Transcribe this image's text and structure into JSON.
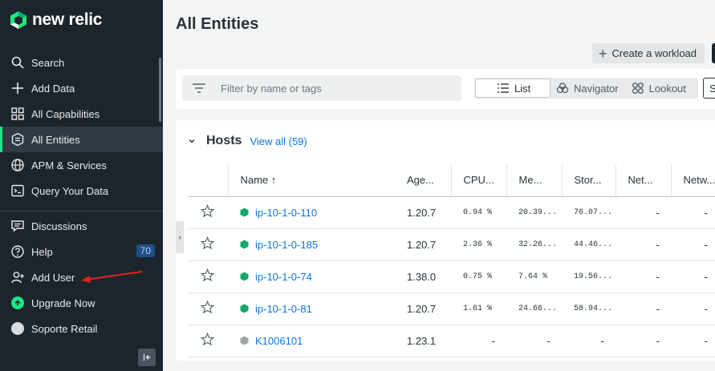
{
  "brand": {
    "name": "new relic",
    "accent": "#1ce783"
  },
  "sidebar": {
    "items": [
      {
        "label": "Search",
        "icon": "search-icon"
      },
      {
        "label": "Add Data",
        "icon": "plus-icon"
      },
      {
        "label": "All Capabilities",
        "icon": "grid-icon"
      },
      {
        "label": "All Entities",
        "icon": "entities-icon",
        "active": true
      },
      {
        "label": "APM & Services",
        "icon": "globe-icon"
      },
      {
        "label": "Query Your Data",
        "icon": "terminal-icon"
      }
    ],
    "bottom_items": [
      {
        "label": "Discussions",
        "icon": "chat-icon"
      },
      {
        "label": "Help",
        "icon": "help-icon",
        "badge": "70"
      },
      {
        "label": "Add User",
        "icon": "add-user-icon"
      },
      {
        "label": "Upgrade Now",
        "icon": "upgrade-icon"
      },
      {
        "label": "Soporte Retail",
        "icon": "avatar-icon"
      }
    ]
  },
  "main": {
    "title": "All Entities",
    "create_workload": "Create a workload",
    "filter_placeholder": "Filter by name or tags",
    "view_tabs": [
      "List",
      "Navigator",
      "Lookout"
    ],
    "view_tab_extra": "S",
    "section": {
      "title": "Hosts",
      "view_all": "View all (59)",
      "columns": [
        "Name ↑",
        "Age...",
        "CPU...",
        "Me...",
        "Stor...",
        "Net...",
        "Netw..."
      ],
      "rows": [
        {
          "name": "ip-10-1-0-110",
          "status": "healthy",
          "age": "1.20.7",
          "cpu": "0.94 %",
          "mem": "20.39...",
          "stor": "76.07...",
          "net": "-",
          "netw": "-"
        },
        {
          "name": "ip-10-1-0-185",
          "status": "healthy",
          "age": "1.20.7",
          "cpu": "2.36 %",
          "mem": "32.26...",
          "stor": "44.46...",
          "net": "-",
          "netw": "-"
        },
        {
          "name": "ip-10-1-0-74",
          "status": "healthy",
          "age": "1.38.0",
          "cpu": "0.75 %",
          "mem": "7.64 %",
          "stor": "19.56...",
          "net": "-",
          "netw": "-"
        },
        {
          "name": "ip-10-1-0-81",
          "status": "healthy",
          "age": "1.20.7",
          "cpu": "1.61 %",
          "mem": "24.66...",
          "stor": "58.94...",
          "net": "-",
          "netw": "-"
        },
        {
          "name": "K1006101",
          "status": "unknown",
          "age": "1.23.1",
          "cpu": "-",
          "mem": "-",
          "stor": "-",
          "net": "-",
          "netw": "-"
        }
      ]
    }
  },
  "colors": {
    "healthy": "#11a968",
    "unknown": "#9ea5a9",
    "link": "#0c74df",
    "sidebar_bg": "#1d252c",
    "annotation": "#e0251d"
  }
}
